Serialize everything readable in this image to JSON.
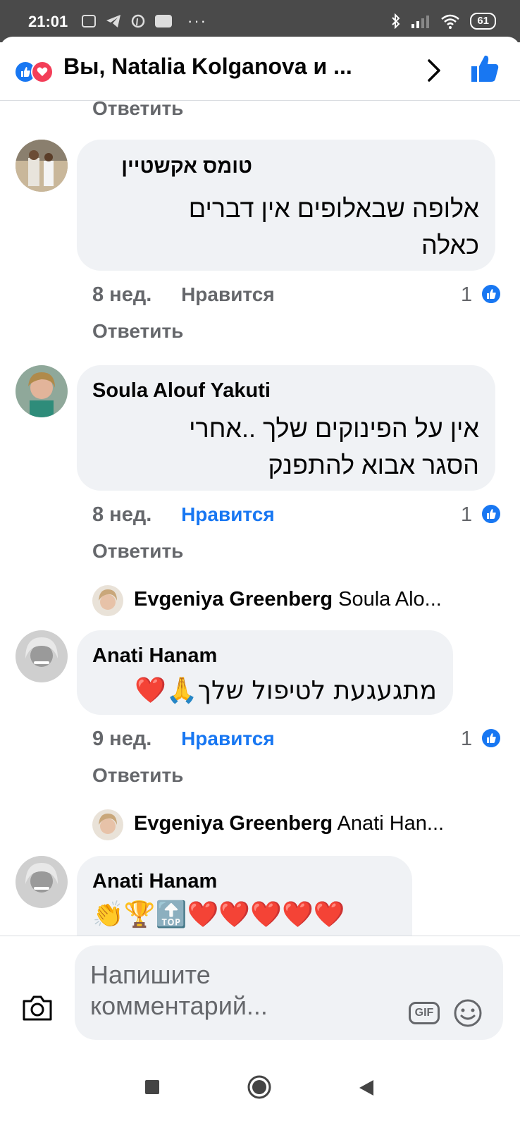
{
  "status_bar": {
    "time": "21:01",
    "battery": "61",
    "icons_left": [
      "news-icon",
      "telegram-icon",
      "pinterest-icon",
      "app-icon"
    ],
    "more": "···"
  },
  "header": {
    "title": "Вы, Natalia Kolganova и ..."
  },
  "top_reply_label": "Ответить",
  "comments": [
    {
      "author": "טומס אקשטיין",
      "lines": [
        "אלופה שבאלופים אין דברים",
        "כאלה"
      ],
      "time": "8 нед.",
      "like_label": "Нравится",
      "like_active": false,
      "reply_label": "Ответить",
      "reactions": "1"
    },
    {
      "author": "Soula Alouf Yakuti",
      "lines": [
        "אין על הפינוקים שלך ..אחרי",
        "הסגר אבוא להתפנק"
      ],
      "time": "8 нед.",
      "like_label": "Нравится",
      "like_active": true,
      "reply_label": "Ответить",
      "reactions": "1",
      "reply_preview": {
        "name": "Evgeniya Greenberg",
        "text": "Soula Alo..."
      }
    },
    {
      "author": "Anati Hanam",
      "lines": [
        "מתגעגעת לטיפול שלך🙏❤️"
      ],
      "time": "9 нед.",
      "like_label": "Нравится",
      "like_active": true,
      "reply_label": "Ответить",
      "reactions": "1",
      "reply_preview": {
        "name": "Evgeniya Greenberg",
        "text": "Anati Han..."
      }
    },
    {
      "author": "Anati Hanam",
      "lines": [
        "👏🏆🔝❤️❤️❤️❤️❤️"
      ]
    }
  ],
  "composer": {
    "placeholder": "Напишите комментарий...",
    "gif_label": "GIF"
  },
  "colors": {
    "accent": "#1877f2",
    "love": "#f33e58",
    "bubble": "#f0f2f5",
    "meta": "#65676b"
  }
}
